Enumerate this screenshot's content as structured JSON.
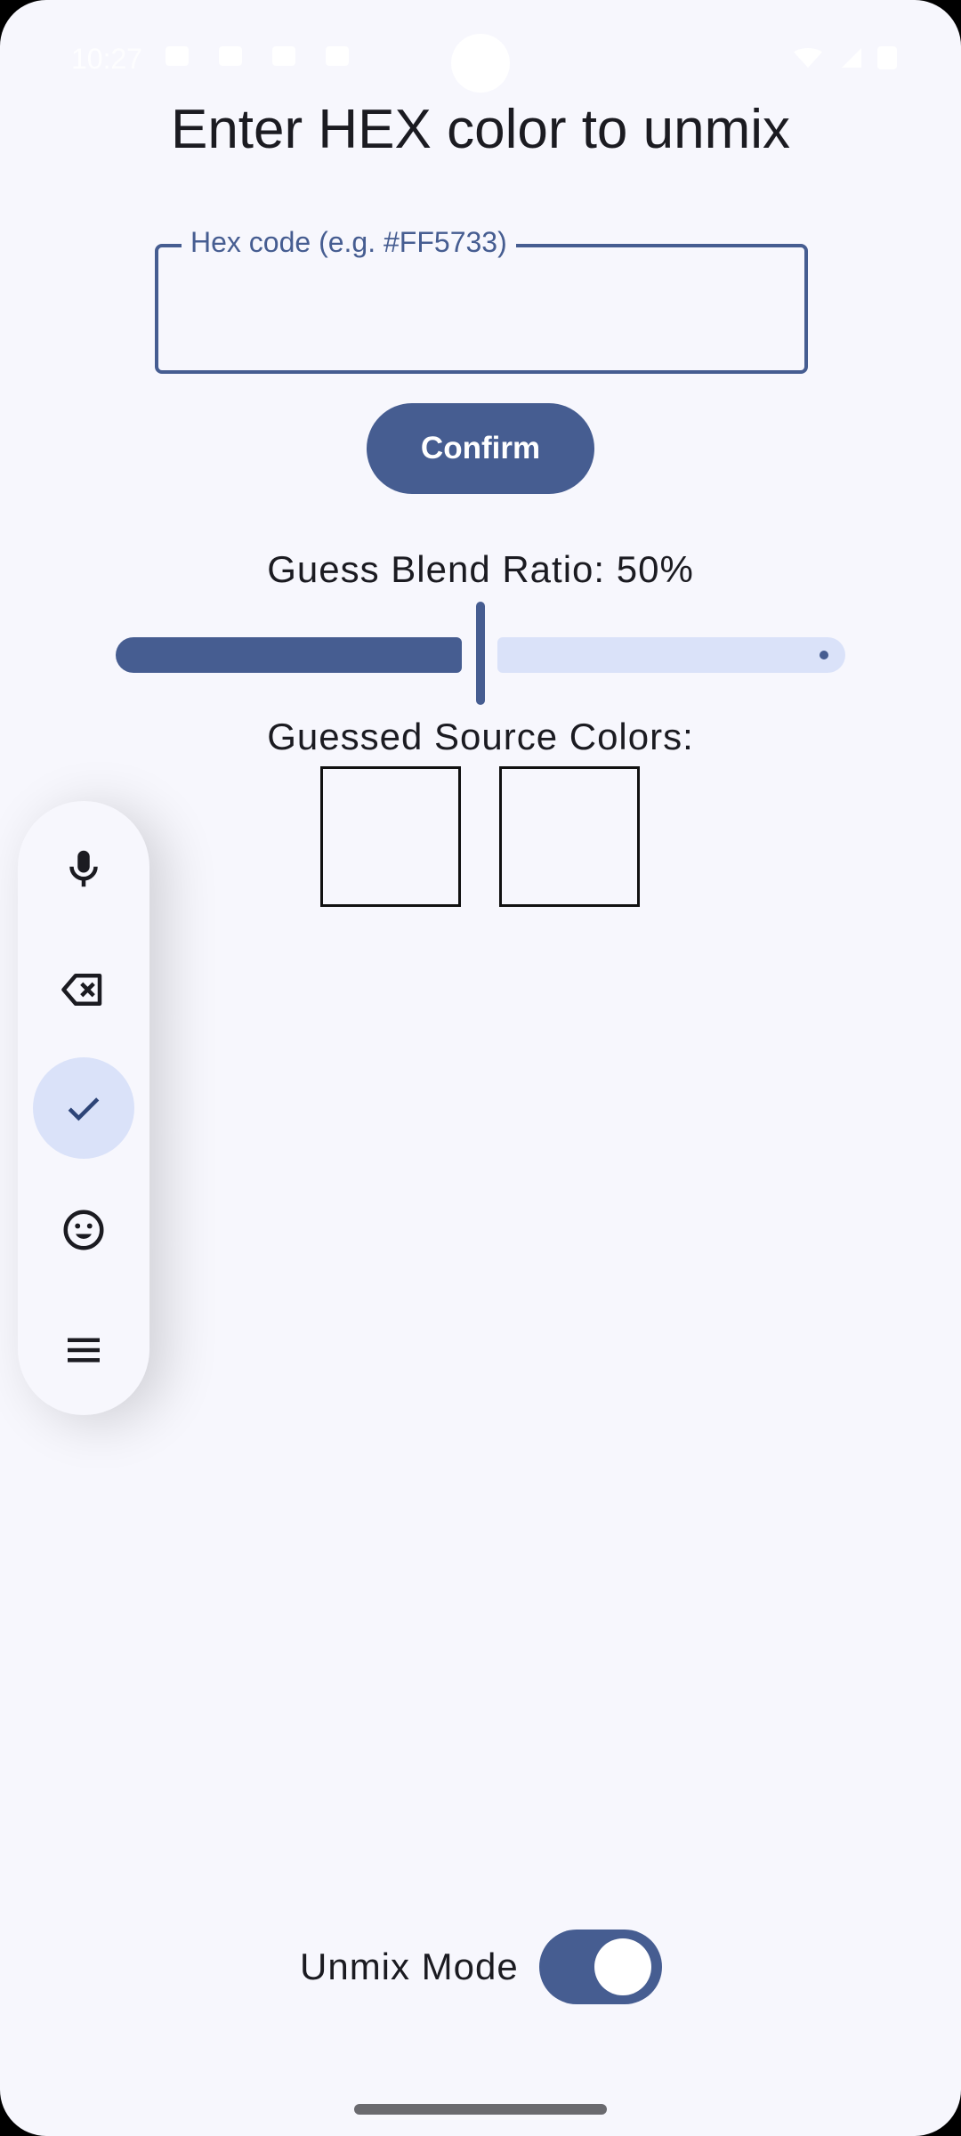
{
  "status_bar": {
    "time": "10:27"
  },
  "main": {
    "title": "Enter HEX color to unmix",
    "hex_field": {
      "label": "Hex code (e.g. #FF5733)",
      "value": ""
    },
    "confirm_label": "Confirm",
    "blend_ratio": {
      "label": "Guess Blend Ratio: 50%",
      "value": 0.5
    },
    "sources_label": "Guessed Source Colors:",
    "swatches": [
      "",
      ""
    ]
  },
  "keyboard_toolbar": {
    "buttons": [
      {
        "icon": "microphone-icon",
        "selected": false
      },
      {
        "icon": "backspace-icon",
        "selected": false
      },
      {
        "icon": "checkmark-icon",
        "selected": true
      },
      {
        "icon": "emoji-icon",
        "selected": false
      },
      {
        "icon": "menu-icon",
        "selected": false
      }
    ]
  },
  "footer": {
    "mode_label": "Unmix Mode",
    "mode_on": true
  },
  "colors": {
    "primary": "#465d91",
    "primary_container": "#dae2f9",
    "background": "#f7f7fd",
    "on_surface": "#1b1b21"
  }
}
